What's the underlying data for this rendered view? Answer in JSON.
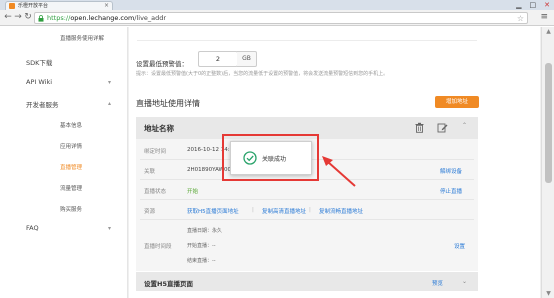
{
  "browser": {
    "tab_title": "乐橙开放平台",
    "tab_close": "×",
    "url_scheme": "https://",
    "url_host": "open.lechange.com",
    "url_path": "/live_addr",
    "window_controls": [
      "▁",
      "□",
      "✕"
    ]
  },
  "sidebar": {
    "items": [
      {
        "label": "直播服务使用详解",
        "type": "sub"
      },
      {
        "label": "SDK下载",
        "type": "top"
      },
      {
        "label": "API Wiki",
        "type": "top",
        "chevron": "▾"
      },
      {
        "label": "开发者服务",
        "type": "top",
        "chevron": "▴"
      },
      {
        "label": "基本信息",
        "type": "sub"
      },
      {
        "label": "应用详情",
        "type": "sub"
      },
      {
        "label": "直播管理",
        "type": "sub",
        "active": true
      },
      {
        "label": "流量管理",
        "type": "sub"
      },
      {
        "label": "购买服务",
        "type": "sub"
      },
      {
        "label": "FAQ",
        "type": "top",
        "chevron": "▾"
      }
    ],
    "active_color": "#f08a24"
  },
  "storage_warning": {
    "label": "设置最低预警值：",
    "value": "2",
    "unit": "GB",
    "hint": "提示：设置最低预警值(大于0的正整数)后，当您的流量低于设置的预警值，将会发送流量预警短信到您的手机上。"
  },
  "section": {
    "title": "直播地址使用详情",
    "add_button": "增加地址"
  },
  "card": {
    "header_title": "地址名称",
    "rows": {
      "bind_time_label": "绑定时间",
      "bind_time_value": "2016-10-12 14:27:45",
      "assoc_label": "关联",
      "assoc_value": "2H01890YAW000",
      "assoc_action": "解绑设备",
      "status_label": "直播状态",
      "status_value": "开始",
      "status_action": "停止直播",
      "resource_label": "资源",
      "resource_links": [
        "获取H5直播页面地址",
        "复制高清直播地址",
        "复制流畅直播地址"
      ],
      "resource_separator": "|",
      "time_label": "直播时间段",
      "time_lines": [
        "直播日期：永久",
        "开始直播：--",
        "结束直播：--"
      ],
      "time_action": "设置"
    }
  },
  "card2": {
    "title": "设置H5直播页面",
    "action": "预览"
  },
  "toast": {
    "message": "关联成功"
  },
  "colors": {
    "accent": "#f08a24",
    "link": "#2b7bd6",
    "status_green": "#55a630",
    "annotation": "#e53935"
  }
}
